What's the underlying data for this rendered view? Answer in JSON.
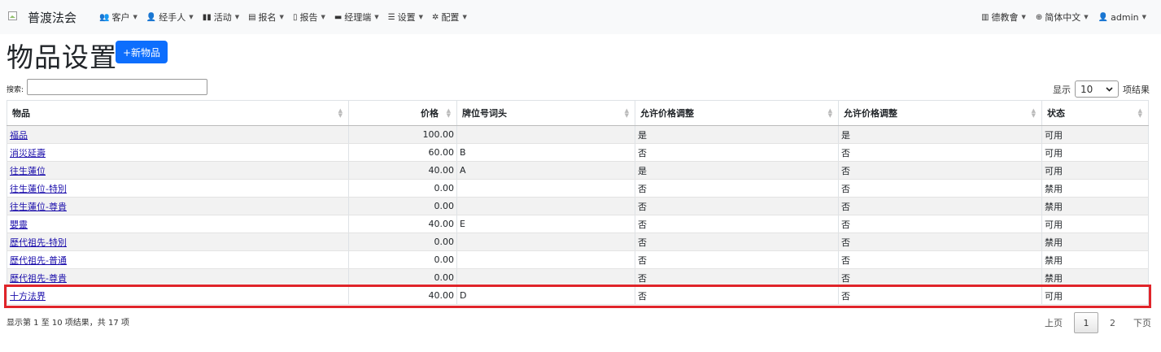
{
  "navbar": {
    "brand": "普渡法会",
    "menu": [
      {
        "icon": "users-icon",
        "glyph": "👥",
        "label": "客户"
      },
      {
        "icon": "person-icon",
        "glyph": "👤",
        "label": "经手人"
      },
      {
        "icon": "map-icon",
        "glyph": "▮▮",
        "label": "活动"
      },
      {
        "icon": "clipboard-icon",
        "glyph": "▤",
        "label": "报名"
      },
      {
        "icon": "document-icon",
        "glyph": "▯",
        "label": "报告"
      },
      {
        "icon": "briefcase-icon",
        "glyph": "▬",
        "label": "经理端"
      },
      {
        "icon": "sliders-icon",
        "glyph": "☰",
        "label": "设置"
      },
      {
        "icon": "gear-icon",
        "glyph": "✲",
        "label": "配置"
      }
    ],
    "right": [
      {
        "icon": "building-icon",
        "glyph": "▥",
        "label": "德教會"
      },
      {
        "icon": "globe-icon",
        "glyph": "⊕",
        "label": "简体中文"
      },
      {
        "icon": "user-icon",
        "glyph": "👤",
        "label": "admin"
      }
    ]
  },
  "page": {
    "title": "物品设置",
    "new_button": "+新物品"
  },
  "table_controls": {
    "search_label": "搜索:",
    "search_value": "",
    "length_prefix": "显示",
    "length_value": "10",
    "length_suffix": "项结果"
  },
  "table": {
    "columns": [
      "物品",
      "价格",
      "牌位号词头",
      "允许价格调整",
      "允许价格调整",
      "状态"
    ],
    "rows": [
      {
        "item": "福品",
        "price": "100.00",
        "prefix": "",
        "adj1": "是",
        "adj2": "是",
        "status": "可用"
      },
      {
        "item": "消災延壽",
        "price": "60.00",
        "prefix": "B",
        "adj1": "否",
        "adj2": "否",
        "status": "可用"
      },
      {
        "item": "往生蓮位",
        "price": "40.00",
        "prefix": "A",
        "adj1": "是",
        "adj2": "否",
        "status": "可用"
      },
      {
        "item": "往生蓮位-特別",
        "price": "0.00",
        "prefix": "",
        "adj1": "否",
        "adj2": "否",
        "status": "禁用"
      },
      {
        "item": "往生蓮位-尊貴",
        "price": "0.00",
        "prefix": "",
        "adj1": "否",
        "adj2": "否",
        "status": "禁用"
      },
      {
        "item": "嬰靈",
        "price": "40.00",
        "prefix": "E",
        "adj1": "否",
        "adj2": "否",
        "status": "可用"
      },
      {
        "item": "歷代祖先-特別",
        "price": "0.00",
        "prefix": "",
        "adj1": "否",
        "adj2": "否",
        "status": "禁用"
      },
      {
        "item": "歷代祖先-普通",
        "price": "0.00",
        "prefix": "",
        "adj1": "否",
        "adj2": "否",
        "status": "禁用"
      },
      {
        "item": "歷代祖先-尊貴",
        "price": "0.00",
        "prefix": "",
        "adj1": "否",
        "adj2": "否",
        "status": "禁用"
      },
      {
        "item": "十方法界",
        "price": "40.00",
        "prefix": "D",
        "adj1": "否",
        "adj2": "否",
        "status": "可用"
      }
    ]
  },
  "footer": {
    "info": "显示第 1 至 10 项结果，共 17 项",
    "pagination": {
      "prev": "上页",
      "pages": [
        "1",
        "2"
      ],
      "active": "1",
      "next": "下页"
    }
  },
  "colors": {
    "primary": "#0d6efd",
    "highlight": "#e0242a",
    "link": "#1a0dab"
  }
}
